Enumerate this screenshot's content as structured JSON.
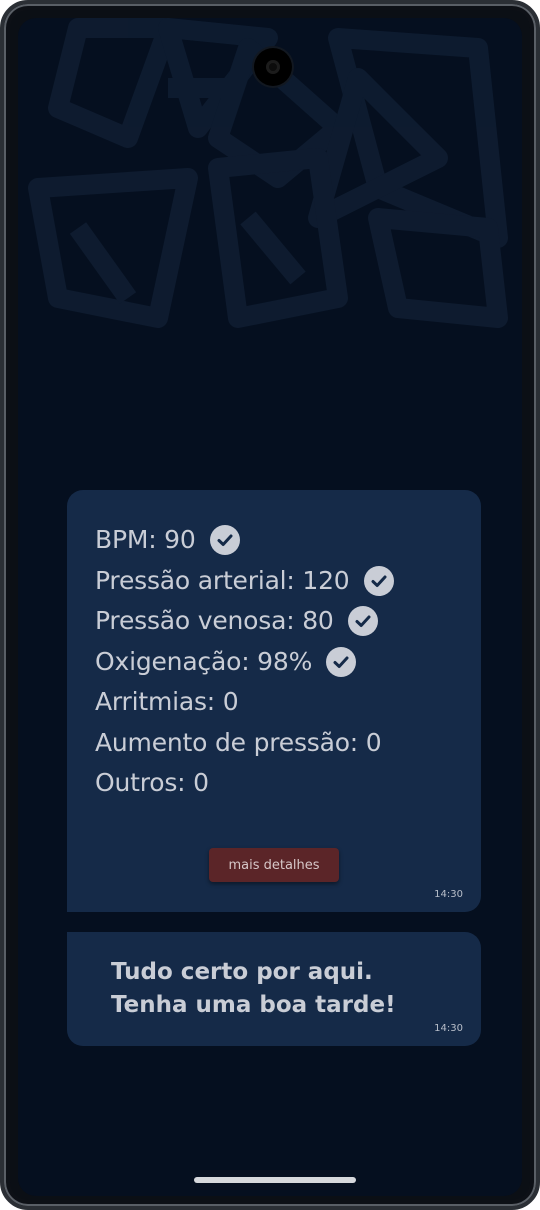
{
  "metrics": [
    {
      "text": "BPM: 90",
      "checked": true
    },
    {
      "text": "Pressão arterial: 120",
      "checked": true
    },
    {
      "text": "Pressão venosa: 80",
      "checked": true
    },
    {
      "text": "Oxigenação: 98%",
      "checked": true
    },
    {
      "text": "Arritmias: 0",
      "checked": false
    },
    {
      "text": "Aumento de pressão: 0",
      "checked": false
    },
    {
      "text": "Outros: 0",
      "checked": false
    }
  ],
  "details_button": {
    "label": "mais detalhes"
  },
  "metrics_time": "14:30",
  "message": {
    "line1": "Tudo certo por aqui.",
    "line2": "Tenha uma boa tarde!",
    "time": "14:30"
  },
  "icons": {
    "check": "check-circle-icon",
    "camera": "front-camera-icon"
  },
  "colors": {
    "background": "#050f1f",
    "bubble": "#152a48",
    "text": "#c9cdd6",
    "button": "#5b2528"
  }
}
